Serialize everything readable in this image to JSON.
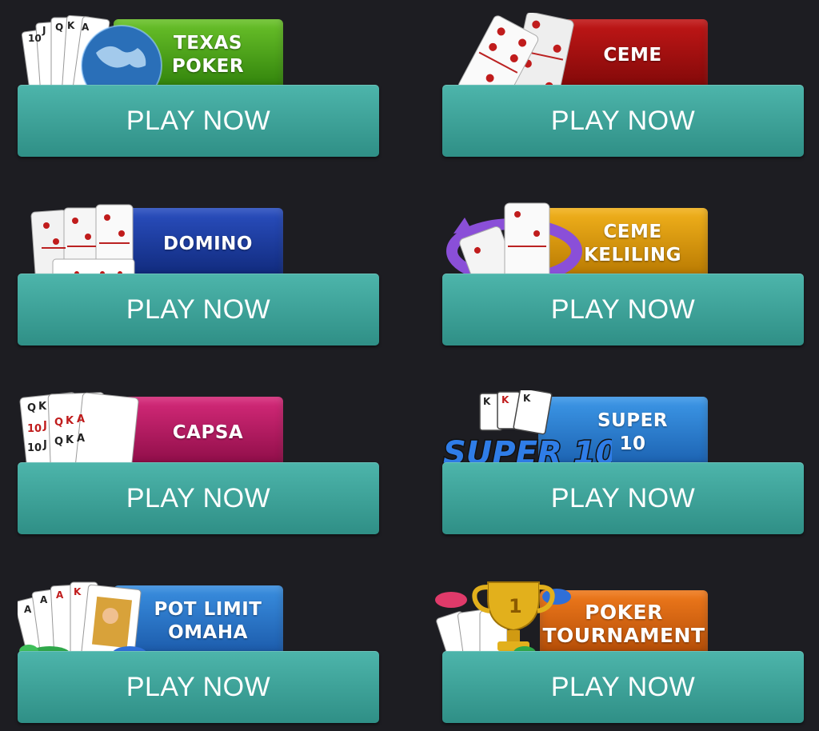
{
  "play_label": "PLAY NOW",
  "games": [
    {
      "title_lines": [
        "TEXAS",
        "POKER"
      ],
      "banner_color": "#3f9a14",
      "icon": "cards-globe-icon"
    },
    {
      "title_lines": [
        "CEME"
      ],
      "banner_color": "#a40d0d",
      "icon": "domino-icon"
    },
    {
      "title_lines": [
        "DOMINO"
      ],
      "banner_color": "#1b3b9c",
      "icon": "dominoes-icon"
    },
    {
      "title_lines": [
        "CEME",
        "KELILING"
      ],
      "banner_color": "#d59206",
      "icon": "domino-rotate-icon"
    },
    {
      "title_lines": [
        "CAPSA"
      ],
      "banner_color": "#b3165f",
      "icon": "cards-fan-icon"
    },
    {
      "title_lines": [
        "SUPER",
        "10"
      ],
      "banner_color": "#2c84d6",
      "icon": "super10-logo-icon",
      "logo_text": "SUPER 10"
    },
    {
      "title_lines": [
        "POT LIMIT",
        "OMAHA"
      ],
      "banner_color": "#2777c9",
      "icon": "cards-chips-icon"
    },
    {
      "title_lines": [
        "POKER",
        "TOURNAMENT"
      ],
      "banner_color": "#d85e10",
      "icon": "trophy-icon"
    }
  ]
}
